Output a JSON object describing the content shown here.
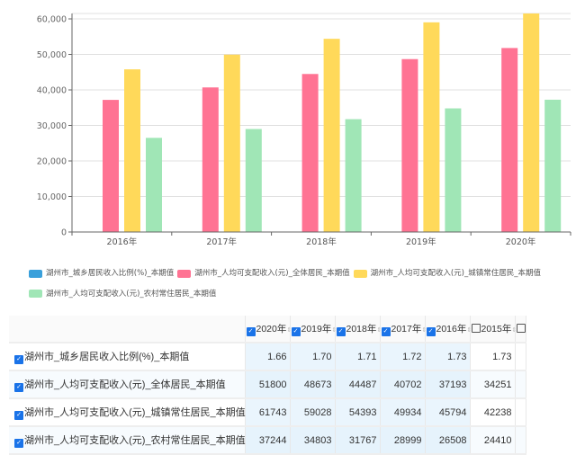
{
  "colors": {
    "ratio": "#3aa0db",
    "all": "#ff7393",
    "urban": "#ffd95a",
    "rural": "#a0e6b6"
  },
  "chart_data": {
    "type": "bar",
    "categories": [
      "2016年",
      "2017年",
      "2018年",
      "2019年",
      "2020年"
    ],
    "ylim": [
      0,
      61500
    ],
    "yticks": [
      "0",
      "10,000",
      "20,000",
      "30,000",
      "40,000",
      "50,000",
      "60,000"
    ],
    "ytick_values": [
      0,
      10000,
      20000,
      30000,
      40000,
      50000,
      60000
    ],
    "grid": true,
    "legend_position": "bottom",
    "series": [
      {
        "name": "湖州市_城乡居民收入比例(%)_本期值",
        "key": "ratio",
        "values": [
          1.73,
          1.72,
          1.71,
          1.7,
          1.66
        ]
      },
      {
        "name": "湖州市_人均可支配收入(元)_全体居民_本期值",
        "key": "all",
        "values": [
          37193,
          40702,
          44487,
          48673,
          51800
        ]
      },
      {
        "name": "湖州市_人均可支配收入(元)_城镇常住居民_本期值",
        "key": "urban",
        "values": [
          45794,
          49934,
          54393,
          59028,
          61743
        ]
      },
      {
        "name": "湖州市_人均可支配收入(元)_农村常住居民_本期值",
        "key": "rural",
        "values": [
          26508,
          28999,
          31767,
          34803,
          37244
        ]
      }
    ]
  },
  "table": {
    "columns": [
      {
        "label": "2020年",
        "checked": true
      },
      {
        "label": "2019年",
        "checked": true
      },
      {
        "label": "2018年",
        "checked": true
      },
      {
        "label": "2017年",
        "checked": true
      },
      {
        "label": "2016年",
        "checked": true
      },
      {
        "label": "2015年",
        "checked": false
      }
    ],
    "rows": [
      {
        "label": "湖州市_城乡居民收入比例(%)_本期值",
        "values": [
          "1.66",
          "1.70",
          "1.71",
          "1.72",
          "1.73",
          "1.73"
        ]
      },
      {
        "label": "湖州市_人均可支配收入(元)_全体居民_本期值",
        "values": [
          "51800",
          "48673",
          "44487",
          "40702",
          "37193",
          "34251"
        ]
      },
      {
        "label": "湖州市_人均可支配收入(元)_城镇常住居民_本期值",
        "values": [
          "61743",
          "59028",
          "54393",
          "49934",
          "45794",
          "42238"
        ]
      },
      {
        "label": "湖州市_人均可支配收入(元)_农村常住居民_本期值",
        "values": [
          "37244",
          "34803",
          "31767",
          "28999",
          "26508",
          "24410"
        ]
      }
    ]
  }
}
